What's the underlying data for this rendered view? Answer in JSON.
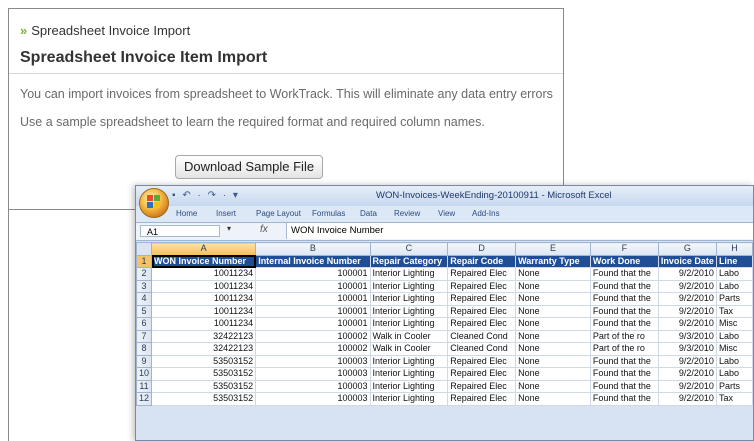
{
  "panel": {
    "breadcrumb_arrow": "»",
    "breadcrumb": "Spreadsheet Invoice Import",
    "title": "Spreadsheet Invoice Item Import",
    "paragraph1": "You can import invoices from spreadsheet to WorkTrack. This will eliminate any data entry errors",
    "paragraph2": "Use a sample spreadsheet to learn the required format and required column names.",
    "download_button": "Download Sample File"
  },
  "excel": {
    "window_title": "WON-Invoices-WeekEnding-20100911  -  Microsoft Excel",
    "quick_access": "▪ ↶ · ↷ · ▾",
    "ribbon_tabs": [
      "Home",
      "Insert",
      "Page Layout",
      "Formulas",
      "Data",
      "Review",
      "View",
      "Add-Ins"
    ],
    "name_box": "A1",
    "name_box_dropdown": "▾",
    "fx_symbol": "fx",
    "formula_value": "WON Invoice Number",
    "column_letters": [
      "A",
      "B",
      "C",
      "D",
      "E",
      "F",
      "G",
      "H"
    ],
    "header_row_number": "1",
    "headers": [
      "WON Invoice Number",
      "Internal Invoice Number",
      "Repair Category",
      "Repair Code",
      "Warranty Type",
      "Work Done",
      "Invoice Date",
      "Line"
    ],
    "rows": [
      {
        "n": "2",
        "cells": [
          "10011234",
          "100001",
          "Interior Lighting",
          "Repaired Elec",
          "None",
          "Found that the",
          "9/2/2010",
          "Labo"
        ]
      },
      {
        "n": "3",
        "cells": [
          "10011234",
          "100001",
          "Interior Lighting",
          "Repaired Elec",
          "None",
          "Found that the",
          "9/2/2010",
          "Labo"
        ]
      },
      {
        "n": "4",
        "cells": [
          "10011234",
          "100001",
          "Interior Lighting",
          "Repaired Elec",
          "None",
          "Found that the",
          "9/2/2010",
          "Parts"
        ]
      },
      {
        "n": "5",
        "cells": [
          "10011234",
          "100001",
          "Interior Lighting",
          "Repaired Elec",
          "None",
          "Found that the",
          "9/2/2010",
          "Tax"
        ]
      },
      {
        "n": "6",
        "cells": [
          "10011234",
          "100001",
          "Interior Lighting",
          "Repaired Elec",
          "None",
          "Found that the",
          "9/2/2010",
          "Misc"
        ]
      },
      {
        "n": "7",
        "cells": [
          "32422123",
          "100002",
          "Walk in Cooler",
          "Cleaned Cond",
          "None",
          "Part of the ro",
          "9/3/2010",
          "Labo"
        ]
      },
      {
        "n": "8",
        "cells": [
          "32422123",
          "100002",
          "Walk in Cooler",
          "Cleaned Cond",
          "None",
          "Part of the ro",
          "9/3/2010",
          "Misc"
        ]
      },
      {
        "n": "9",
        "cells": [
          "53503152",
          "100003",
          "Interior Lighting",
          "Repaired Elec",
          "None",
          "Found that the",
          "9/2/2010",
          "Labo"
        ]
      },
      {
        "n": "10",
        "cells": [
          "53503152",
          "100003",
          "Interior Lighting",
          "Repaired Elec",
          "None",
          "Found that the",
          "9/2/2010",
          "Labo"
        ]
      },
      {
        "n": "11",
        "cells": [
          "53503152",
          "100003",
          "Interior Lighting",
          "Repaired Elec",
          "None",
          "Found that the",
          "9/2/2010",
          "Parts"
        ]
      },
      {
        "n": "12",
        "cells": [
          "53503152",
          "100003",
          "Interior Lighting",
          "Repaired Elec",
          "None",
          "Found that the",
          "9/2/2010",
          "Tax"
        ]
      }
    ],
    "colors": {
      "header_fill": "#1f4e96",
      "header_text": "#ffffff",
      "selection": "#f5be5a"
    }
  }
}
